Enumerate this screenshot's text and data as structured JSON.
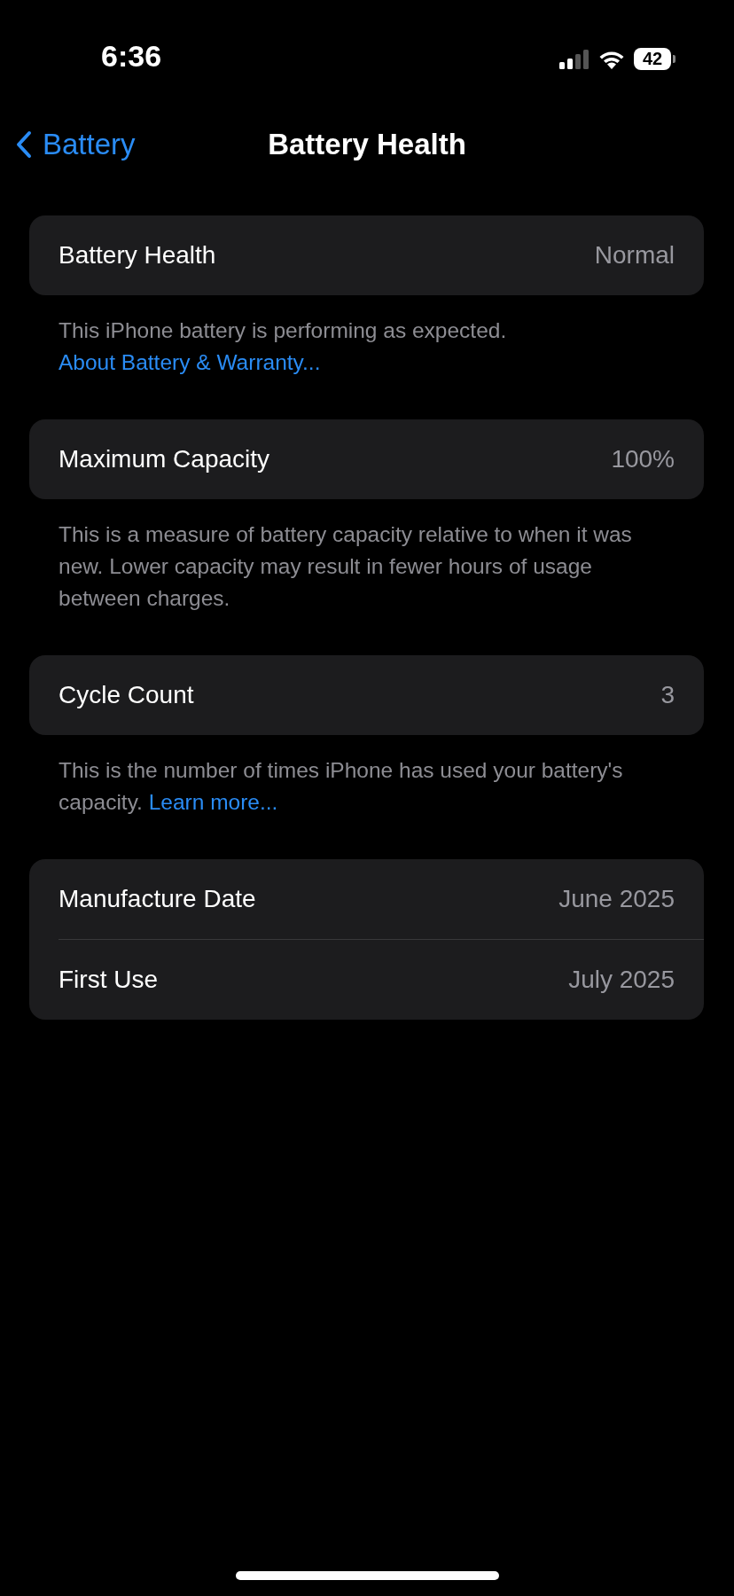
{
  "status_bar": {
    "time": "6:36",
    "battery": "42"
  },
  "nav": {
    "back": "Battery",
    "title": "Battery Health"
  },
  "sections": [
    {
      "rows": [
        {
          "label": "Battery Health",
          "value": "Normal"
        }
      ],
      "footer": [
        {
          "text": "This iPhone battery is performing as expected. ",
          "kind": "plain"
        },
        {
          "text": "About Battery & Warranty...",
          "kind": "link"
        }
      ]
    },
    {
      "rows": [
        {
          "label": "Maximum Capacity",
          "value": "100%"
        }
      ],
      "footer": [
        {
          "text": "This is a measure of battery capacity relative to when it was new. Lower capacity may result in fewer hours of usage between charges.",
          "kind": "plain"
        }
      ]
    },
    {
      "rows": [
        {
          "label": "Cycle Count",
          "value": "3"
        }
      ],
      "footer": [
        {
          "text": "This is the number of times iPhone has used your battery's capacity. ",
          "kind": "plain"
        },
        {
          "text": "Learn more...",
          "kind": "link"
        }
      ]
    },
    {
      "rows": [
        {
          "label": "Manufacture Date",
          "value": "June 2025"
        },
        {
          "label": "First Use",
          "value": "July 2025"
        }
      ]
    }
  ]
}
